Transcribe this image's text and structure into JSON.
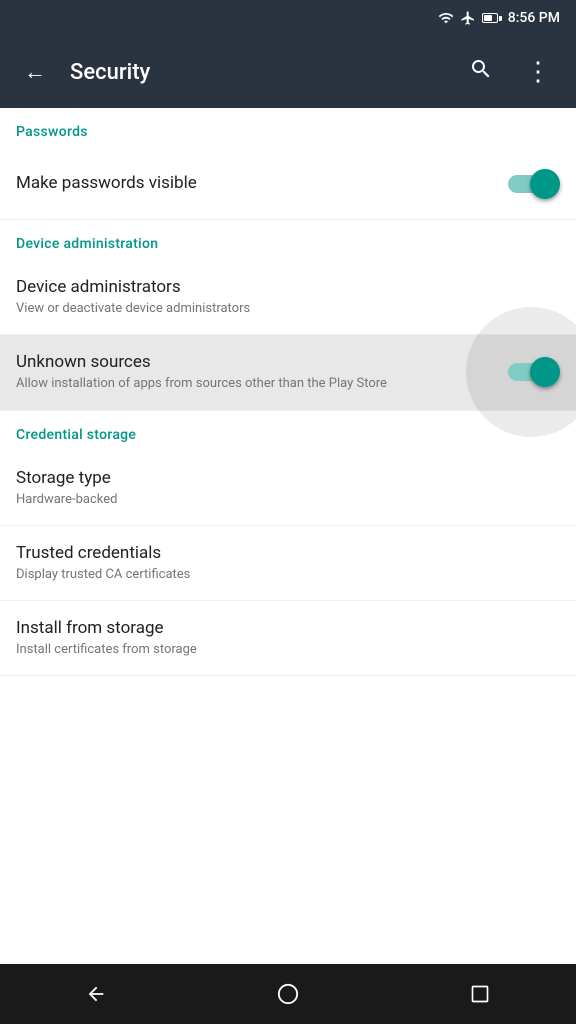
{
  "statusBar": {
    "time": "8:56 PM"
  },
  "toolbar": {
    "title": "Security",
    "backLabel": "←",
    "searchLabel": "⌕",
    "moreLabel": "⋮"
  },
  "sections": [
    {
      "id": "passwords",
      "header": "Passwords",
      "items": [
        {
          "id": "make-passwords-visible",
          "title": "Make passwords visible",
          "subtitle": "",
          "hasToggle": true,
          "toggleOn": true,
          "highlighted": false
        }
      ]
    },
    {
      "id": "device-administration",
      "header": "Device administration",
      "items": [
        {
          "id": "device-administrators",
          "title": "Device administrators",
          "subtitle": "View or deactivate device administrators",
          "hasToggle": false,
          "highlighted": false
        },
        {
          "id": "unknown-sources",
          "title": "Unknown sources",
          "subtitle": "Allow installation of apps from sources other than the Play Store",
          "hasToggle": true,
          "toggleOn": true,
          "highlighted": true,
          "hasRipple": true
        }
      ]
    },
    {
      "id": "credential-storage",
      "header": "Credential storage",
      "items": [
        {
          "id": "storage-type",
          "title": "Storage type",
          "subtitle": "Hardware-backed",
          "hasToggle": false,
          "highlighted": false
        },
        {
          "id": "trusted-credentials",
          "title": "Trusted credentials",
          "subtitle": "Display trusted CA certificates",
          "hasToggle": false,
          "highlighted": false
        },
        {
          "id": "install-from-storage",
          "title": "Install from storage",
          "subtitle": "Install certificates from storage",
          "hasToggle": false,
          "highlighted": false
        }
      ]
    }
  ],
  "navBar": {
    "backIcon": "◁",
    "homeIcon": "○",
    "recentIcon": "□"
  }
}
